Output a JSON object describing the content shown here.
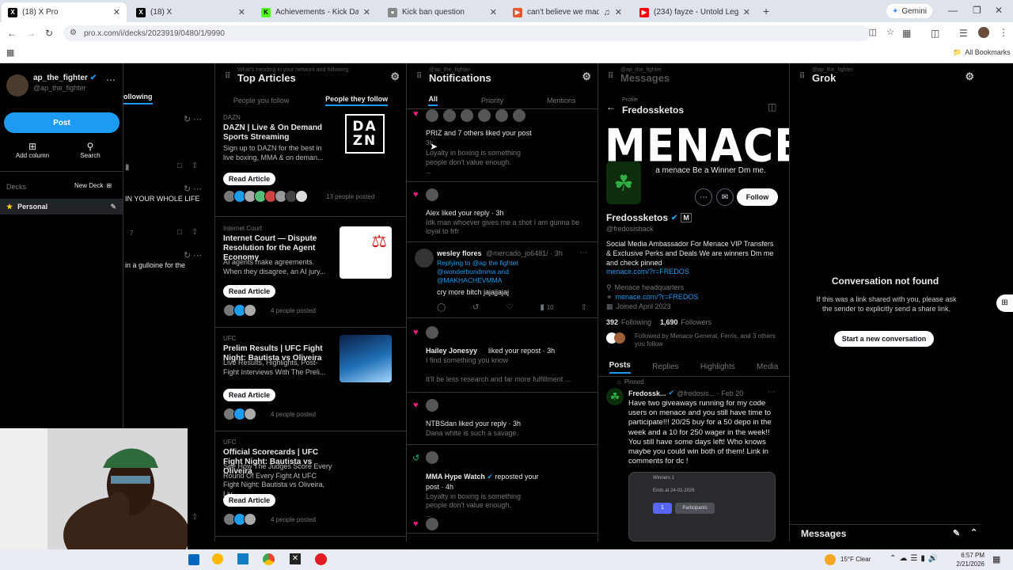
{
  "browser": {
    "tabs": [
      {
        "title": "(18) X Pro",
        "active": true
      },
      {
        "title": "(18) X",
        "active": false
      },
      {
        "title": "Achievements - Kick Dashboard",
        "active": false
      },
      {
        "title": "Kick ban question",
        "active": false
      },
      {
        "title": "can't believe we made 1...",
        "active": false
      },
      {
        "title": "(234) fayze - Untold Legacy (O...",
        "active": false
      }
    ],
    "gemini_label": "Gemini",
    "url": "pro.x.com/i/decks/2023919/0480/1/9990",
    "all_bookmarks": "All Bookmarks"
  },
  "sidebar": {
    "username": "ap_the_fighter",
    "handle": "@ap_the_fighter",
    "post_button": "Post",
    "add_column": "Add column",
    "search": "Search",
    "decks_label": "Decks",
    "new_deck": "New Deck",
    "deck_personal": "Personal"
  },
  "following_col": {
    "tab_label": "ollowing",
    "snippet1": "IN YOUR WHOLE LIFE",
    "count": "7",
    "snippet2": "in a gulloine for the"
  },
  "articles": {
    "header_sub": "What's trending in your network and following",
    "title": "Top Articles",
    "tab_people_you_follow": "People you follow",
    "tab_people_they_follow": "People they follow",
    "read_article": "Read Article",
    "items": [
      {
        "source": "DAZN",
        "title": "DAZN | Live & On Demand Sports Streaming",
        "desc": "Sign up to DAZN for the best in live boxing, MMA & on deman...",
        "posted": "13 people posted",
        "thumb": "DAZN"
      },
      {
        "source": "Internet Court",
        "title": "Internet Court — Dispute Resolution for the Agent Economy",
        "desc": "AI agents make agreements. When they disagree, an AI jury...",
        "posted": "4 people posted",
        "thumb": "the agent my"
      },
      {
        "source": "UFC",
        "title": "Prelim Results | UFC Fight Night: Bautista vs Oliveira",
        "desc": "Live Results, Highlights, Post-Fight Interviews With The Preli...",
        "posted": "4 people posted",
        "thumb": ""
      },
      {
        "source": "UFC",
        "title": "Official Scorecards | UFC Fight Night: Bautista vs Oliveira",
        "desc": "See How The Judges Score Every Round Of Every Fight At UFC Fight Night: Bautista vs Oliveira, Liv...",
        "posted": "4 people posted",
        "thumb": ""
      }
    ]
  },
  "notifications": {
    "header_sub": "@ap_the_fighter",
    "title": "Notifications",
    "tabs": [
      "All",
      "Priority",
      "Mentions"
    ],
    "items": [
      {
        "type": "like",
        "text": "PRIZ and 7 others liked your post",
        "time": "3h",
        "body": "Loyalty in boxing is something people don't value enough."
      },
      {
        "type": "like",
        "text": "Alex liked your reply · 3h",
        "body": "Idk man whoever gives me a shot I am gunna be loyal to frfr"
      },
      {
        "type": "reply",
        "name": "wesley flores",
        "handle": "@mercado_jo6481/ · 3h",
        "replying": "Replying to @ap the fighter @wonderbondmma and @MAKHACHEVMMA",
        "body": "cry more bitch jajajjajaj",
        "views": "10"
      },
      {
        "type": "like",
        "name": "Hailey Jonesyy",
        "text": "liked your repost · 3h",
        "body": "I find something you know",
        "body2": "It'll be less research and far more fulfillment ..."
      },
      {
        "type": "like",
        "text": "NTBSdan liked your reply · 3h",
        "body": "Dana white is such a savage."
      },
      {
        "type": "repost",
        "name": "MMA Hype Watch",
        "text": "reposted your post · 4h",
        "body": "Loyalty in boxing is something people don't value enough."
      }
    ]
  },
  "messages": {
    "header_sub": "@ap_the_fighter",
    "title": "Messages",
    "profile_sub": "Profile",
    "profile_title": "Fredossketos",
    "banner_text": "MENACE",
    "banner_sub": "a menace Be a Winner Dm me.",
    "follow_button": "Follow",
    "name": "Fredossketos",
    "handle": "@fredosisback",
    "bio": "Social Media Ambassador For Menace VIP Transfers & Exclusive Perks and Deals We are winners Dm me and check pinned",
    "link": "menace.com/?r=FREDOS",
    "location": "Menace headquarters",
    "website": "menace.com/?r=FREDOS",
    "joined": "Joined April 2023",
    "following_count": "392",
    "following_label": "Following",
    "followers_count": "1,690",
    "followers_label": "Followers",
    "followed_by": "Followed by Menace General, Ferris, and 3 others you follow",
    "tabs": [
      "Posts",
      "Replies",
      "Highlights",
      "Media"
    ],
    "pinned_label": "Pinned",
    "post_name": "Fredossk...",
    "post_handle": "@fredosis... · Feb 20",
    "post_body": "Have two giveaways running for my code users on menace and you still have time to participate!!! 20/25 buy for a 50 depo in the week and a 10 for 250 wager in the week!! You still have some days left! Who knows maybe you could win both of them! Link in comments for dc !",
    "embed_line1": "Winners 1",
    "embed_line2": "Ends at 24-02-2026",
    "embed_count": "1",
    "embed_participants": "Participants"
  },
  "grok": {
    "header_sub": "@ap_the_fighter",
    "title": "Grok",
    "conv_title": "Conversation not found",
    "conv_body": "If this was a link shared with you, please ask the sender to explicitly send a share link.",
    "new_conv_button": "Start a new conversation",
    "messages_bar": "Messages"
  },
  "taskbar": {
    "weather": "15°F Clear",
    "time": "6:57 PM",
    "date": "2/21/2026"
  }
}
